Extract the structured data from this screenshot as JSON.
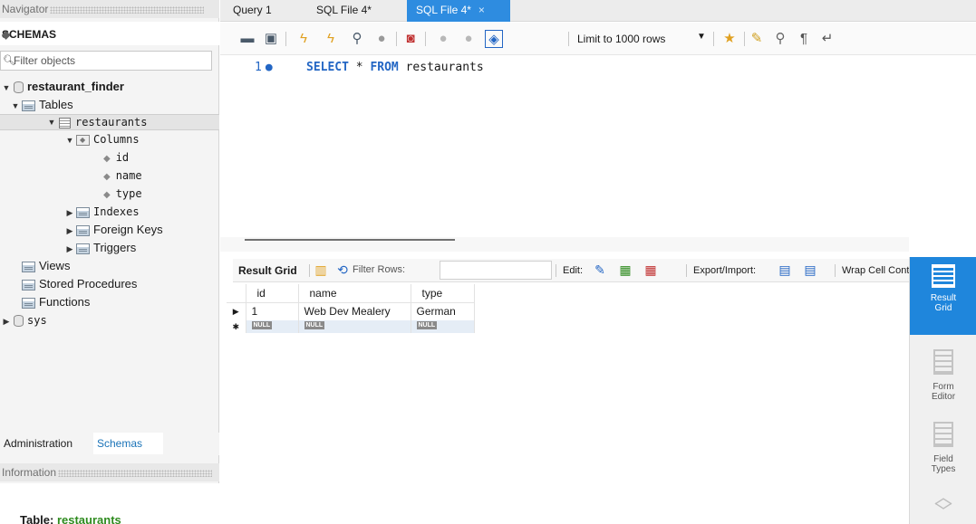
{
  "navigator": {
    "title": "Navigator",
    "schemas_label": "SCHEMAS",
    "filter_placeholder": "Filter objects",
    "tree": {
      "db1": "restaurant_finder",
      "tables": "Tables",
      "table1": "restaurants",
      "columns": "Columns",
      "col_id": "id",
      "col_name": "name",
      "col_type": "type",
      "indexes": "Indexes",
      "foreign_keys": "Foreign Keys",
      "triggers": "Triggers",
      "views": "Views",
      "stored_procedures": "Stored Procedures",
      "functions": "Functions",
      "db2": "sys"
    },
    "bottom_tabs": {
      "administration": "Administration",
      "schemas": "Schemas"
    },
    "information": {
      "title": "Information",
      "table_prefix": "Table:",
      "table_name": "restaurants"
    }
  },
  "editor_tabs": {
    "query1": "Query 1",
    "sqlfile_a": "SQL File 4*",
    "sqlfile_b": "SQL File 4*",
    "close": "×"
  },
  "toolbar": {
    "limit_label": "Limit to 1000 rows"
  },
  "editor": {
    "line_number": "1",
    "kw_select": "SELECT",
    "star": " * ",
    "kw_from": "FROM",
    "table": " restaurants"
  },
  "result_toolbar": {
    "result_grid": "Result Grid",
    "filter_rows": "Filter Rows:",
    "edit": "Edit:",
    "export_import": "Export/Import:",
    "wrap_cell": "Wrap Cell Content"
  },
  "grid": {
    "columns": [
      "id",
      "name",
      "type"
    ],
    "rows": [
      {
        "id": "1",
        "name": "Web Dev Mealery",
        "type": "German"
      }
    ],
    "null_tag": "NULL"
  },
  "side_panel": {
    "result_grid": [
      "Result",
      "Grid"
    ],
    "form_editor": [
      "Form",
      "Editor"
    ],
    "field_types": [
      "Field",
      "Types"
    ]
  },
  "colors": {
    "accent": "#2e8ce0",
    "keyword": "#2366c4",
    "table_name": "#2e8b1e"
  }
}
